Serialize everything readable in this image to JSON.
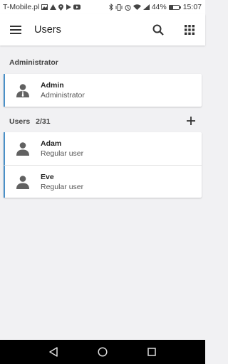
{
  "status_bar": {
    "carrier": "T-Mobile.pl",
    "battery": "44%",
    "battery_level": 0.44,
    "time": "15:07",
    "left_icons": [
      "image-icon",
      "warning-icon",
      "location-icon",
      "play-icon",
      "youtube-icon"
    ],
    "right_icons": [
      "bluetooth-icon",
      "vibrate-icon",
      "alarm-icon",
      "wifi-icon",
      "signal-icon"
    ]
  },
  "app_bar": {
    "title": "Users",
    "icons": [
      "menu-icon",
      "search-icon",
      "grid-icon"
    ]
  },
  "administrator_section": {
    "header": "Administrator",
    "items": [
      {
        "name": "Admin",
        "role": "Administrator",
        "icon": "admin-avatar-icon"
      }
    ]
  },
  "users_section": {
    "header": "Users",
    "count": "2/31",
    "add_icon": "plus-icon",
    "items": [
      {
        "name": "Adam",
        "role": "Regular user",
        "icon": "user-avatar-icon"
      },
      {
        "name": "Eve",
        "role": "Regular user",
        "icon": "user-avatar-icon"
      }
    ]
  },
  "nav_bar": {
    "icons": [
      "back-icon",
      "home-icon",
      "recents-icon"
    ]
  },
  "colors": {
    "accent": "#4a90c8",
    "background": "#f1f1f3",
    "icon": "#616161"
  }
}
